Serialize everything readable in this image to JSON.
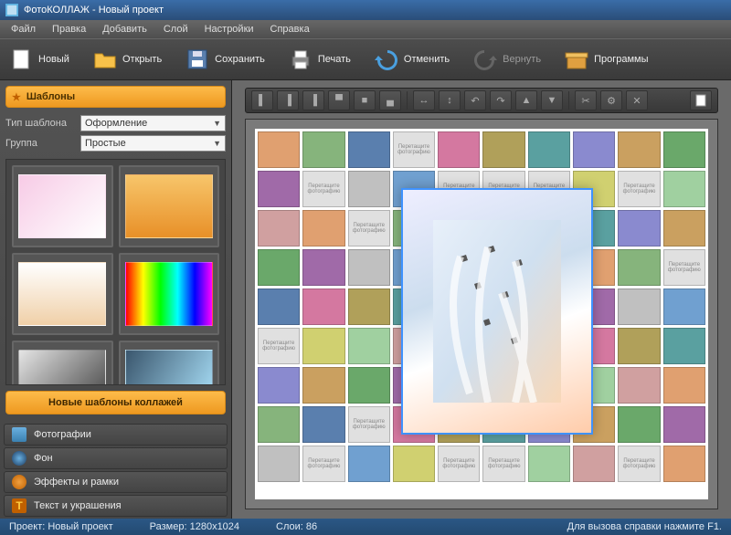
{
  "title": "ФотоКОЛЛАЖ - Новый проект",
  "menu": [
    "Файл",
    "Правка",
    "Добавить",
    "Слой",
    "Настройки",
    "Справка"
  ],
  "toolbar": {
    "new": "Новый",
    "open": "Открыть",
    "save": "Сохранить",
    "print": "Печать",
    "undo": "Отменить",
    "redo": "Вернуть",
    "programs": "Программы"
  },
  "left": {
    "templates_header": "Шаблоны",
    "template_type_label": "Тип шаблона",
    "template_type_value": "Оформление",
    "group_label": "Группа",
    "group_value": "Простые",
    "new_templates_btn": "Новые шаблоны коллажей",
    "tabs": {
      "photos": "Фотографии",
      "background": "Фон",
      "effects": "Эффекты и рамки",
      "text": "Текст и украшения"
    }
  },
  "placeholders": {
    "drag": "Перетащите",
    "photo": "фотографию"
  },
  "status": {
    "project_label": "Проект:",
    "project_value": "Новый проект",
    "size_label": "Размер:",
    "size_value": "1280x1024",
    "layers_label": "Слои:",
    "layers_value": "86",
    "help_hint": "Для вызова справки нажмите F1."
  },
  "colors": {
    "accent": "#ee9920",
    "select": "#3e92ff"
  },
  "template_previews": [
    {
      "bg": "linear-gradient(135deg,#f7cbe6,#fff)",
      "selected": false
    },
    {
      "bg": "linear-gradient(#f7c56a,#e89028)",
      "selected": false
    },
    {
      "bg": "linear-gradient(180deg,#fff,#f0d0a8)",
      "selected": false
    },
    {
      "bg": "linear-gradient(90deg,#f00,#ff0,#0f0,#0ff,#00f,#f0f)",
      "selected": false
    },
    {
      "bg": "linear-gradient(135deg,#e5e5e5,#3a3a3a)",
      "selected": false
    },
    {
      "bg": "linear-gradient(120deg,#3a566d,#aee6ff)",
      "selected": false
    }
  ],
  "edit_tool_icons": [
    "align-left",
    "align-center",
    "align-right",
    "align-top",
    "align-middle",
    "align-bottom",
    "flip-h",
    "flip-v",
    "rotate-left",
    "rotate-right",
    "bring-front",
    "send-back",
    "crop",
    "settings",
    "delete",
    "blank"
  ],
  "collage_cells": [
    [
      "img",
      "img",
      "img",
      "ph",
      "img",
      "img",
      "img",
      "img",
      "img",
      "img"
    ],
    [
      "img",
      "ph",
      "img",
      "img",
      "ph",
      "ph",
      "ph",
      "img",
      "ph",
      "img"
    ],
    [
      "img",
      "img",
      "ph",
      "img",
      "img",
      "img",
      "img",
      "img",
      "img",
      "img"
    ],
    [
      "img",
      "img",
      "img",
      "img",
      "img",
      "img",
      "img",
      "img",
      "img",
      "ph"
    ],
    [
      "img",
      "img",
      "img",
      "img",
      "img",
      "img",
      "img",
      "img",
      "img",
      "img"
    ],
    [
      "ph",
      "img",
      "img",
      "img",
      "img",
      "img",
      "img",
      "img",
      "img",
      "img"
    ],
    [
      "img",
      "img",
      "img",
      "img",
      "img",
      "img",
      "img",
      "img",
      "img",
      "img"
    ],
    [
      "img",
      "img",
      "ph",
      "img",
      "img",
      "img",
      "img",
      "img",
      "img",
      "img"
    ],
    [
      "img",
      "ph",
      "img",
      "img",
      "ph",
      "ph",
      "img",
      "img",
      "ph",
      "img"
    ]
  ],
  "cell_colors": [
    "#e0a070",
    "#86b47c",
    "#5a7fae",
    "#d478a0",
    "#b0a05a",
    "#5aa0a0",
    "#8a8acf",
    "#caa060",
    "#6aa86a",
    "#a06aa8",
    "#c0c0c0",
    "#70a0d0",
    "#d0d070",
    "#a0d0a0",
    "#d0a0a0"
  ]
}
